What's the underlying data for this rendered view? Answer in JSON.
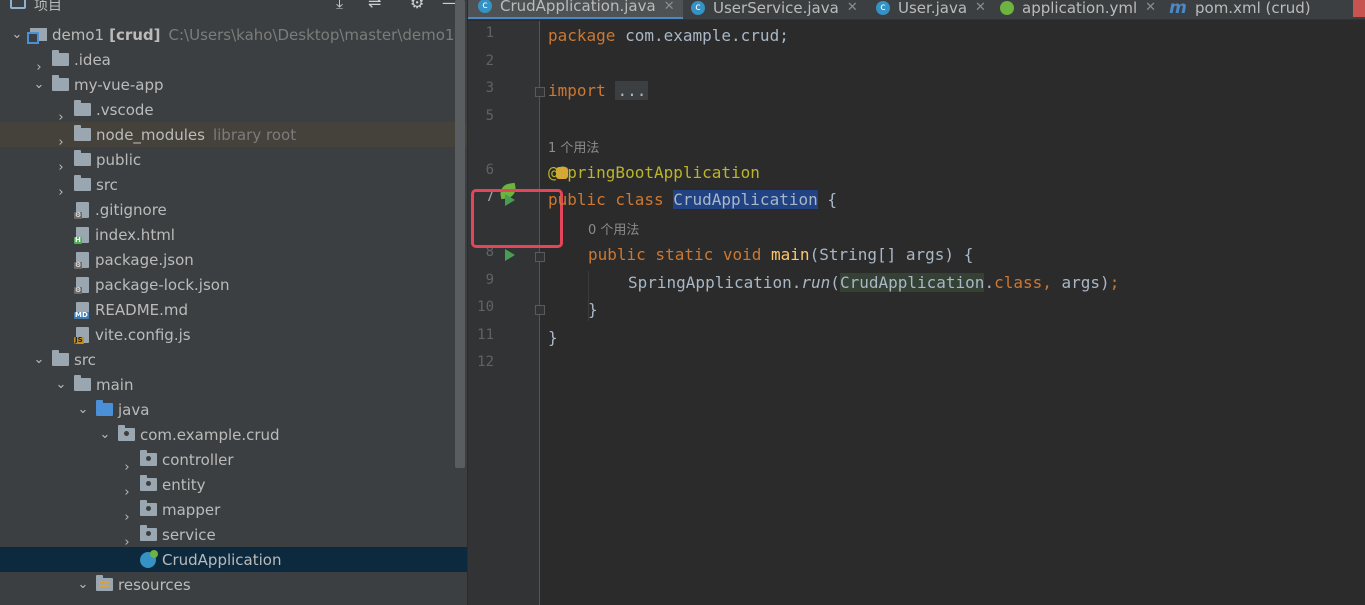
{
  "panel": {
    "title": "项目",
    "header_icons": [
      "collapse-all-icon",
      "expand-icon",
      "settings-icon",
      "minimize-icon"
    ]
  },
  "tree": [
    {
      "depth": 0,
      "arrow": "open",
      "icon": "module",
      "label": "demo1",
      "bold_suffix": "[crud]",
      "hint": "C:\\Users\\kaho\\Desktop\\master\\demo1"
    },
    {
      "depth": 1,
      "arrow": "closed",
      "icon": "folder",
      "label": ".idea"
    },
    {
      "depth": 1,
      "arrow": "open",
      "icon": "folder",
      "label": "my-vue-app"
    },
    {
      "depth": 2,
      "arrow": "closed",
      "icon": "folder",
      "label": ".vscode"
    },
    {
      "depth": 2,
      "arrow": "closed",
      "icon": "folder",
      "label": "node_modules",
      "hint": "library root",
      "highlight": true
    },
    {
      "depth": 2,
      "arrow": "closed",
      "icon": "folder",
      "label": "public"
    },
    {
      "depth": 2,
      "arrow": "closed",
      "icon": "folder",
      "label": "src"
    },
    {
      "depth": 2,
      "arrow": "none",
      "icon": "file-cfg",
      "label": ".gitignore"
    },
    {
      "depth": 2,
      "arrow": "none",
      "icon": "file-h",
      "label": "index.html"
    },
    {
      "depth": 2,
      "arrow": "none",
      "icon": "file-cfg",
      "label": "package.json"
    },
    {
      "depth": 2,
      "arrow": "none",
      "icon": "file-cfg",
      "label": "package-lock.json"
    },
    {
      "depth": 2,
      "arrow": "none",
      "icon": "file-md",
      "label": "README.md"
    },
    {
      "depth": 2,
      "arrow": "none",
      "icon": "file-js",
      "label": "vite.config.js"
    },
    {
      "depth": 1,
      "arrow": "open",
      "icon": "folder",
      "label": "src"
    },
    {
      "depth": 2,
      "arrow": "open",
      "icon": "folder",
      "label": "main"
    },
    {
      "depth": 3,
      "arrow": "open",
      "icon": "folder-blue",
      "label": "java"
    },
    {
      "depth": 4,
      "arrow": "open",
      "icon": "folder-pkg",
      "label": "com.example.crud"
    },
    {
      "depth": 5,
      "arrow": "closed",
      "icon": "folder-pkg",
      "label": "controller"
    },
    {
      "depth": 5,
      "arrow": "closed",
      "icon": "folder-pkg",
      "label": "entity"
    },
    {
      "depth": 5,
      "arrow": "closed",
      "icon": "folder-pkg",
      "label": "mapper"
    },
    {
      "depth": 5,
      "arrow": "closed",
      "icon": "folder-pkg",
      "label": "service"
    },
    {
      "depth": 5,
      "arrow": "none",
      "icon": "spring",
      "label": "CrudApplication",
      "selected": true
    },
    {
      "depth": 3,
      "arrow": "open",
      "icon": "folder-res",
      "label": "resources"
    }
  ],
  "tabs": [
    {
      "label": "CrudApplication.java",
      "icon": "spring-class-icon",
      "active": true
    },
    {
      "label": "UserService.java",
      "icon": "class-icon",
      "active": false
    },
    {
      "label": "User.java",
      "icon": "class-icon",
      "active": false
    },
    {
      "label": "application.yml",
      "icon": "spring-config-icon",
      "active": false
    },
    {
      "label": "pom.xml (crud)",
      "icon": "maven-icon",
      "active": false
    }
  ],
  "tab_close_glyph": "✕",
  "gutter": {
    "line_numbers": [
      "1",
      "2",
      "3",
      "5",
      "6",
      "7",
      "8",
      "9",
      "10",
      "11",
      "12"
    ],
    "current_line": "7"
  },
  "code": {
    "line1": {
      "kw": "package",
      "rest": " com.example.crud;"
    },
    "line3": {
      "kw": "import",
      "folded": "..."
    },
    "usage1": "1 个用法",
    "line6": {
      "ann": "@SpringBootApplication"
    },
    "line7": {
      "kw": "public class",
      "name": "CrudApplication",
      "rest": " {"
    },
    "usage2": "0 个用法",
    "line8": {
      "kw": "public static void",
      "fn": "main",
      "rest": "(String[] args) {"
    },
    "line9": {
      "cls": "SpringApplication.",
      "call": "run",
      "open": "(",
      "ref": "CrudApplication",
      "dot": ".",
      "kw": "class",
      "comma": ",",
      "args": " args)",
      "semi": ";"
    },
    "line10": "}",
    "line11": "}"
  }
}
